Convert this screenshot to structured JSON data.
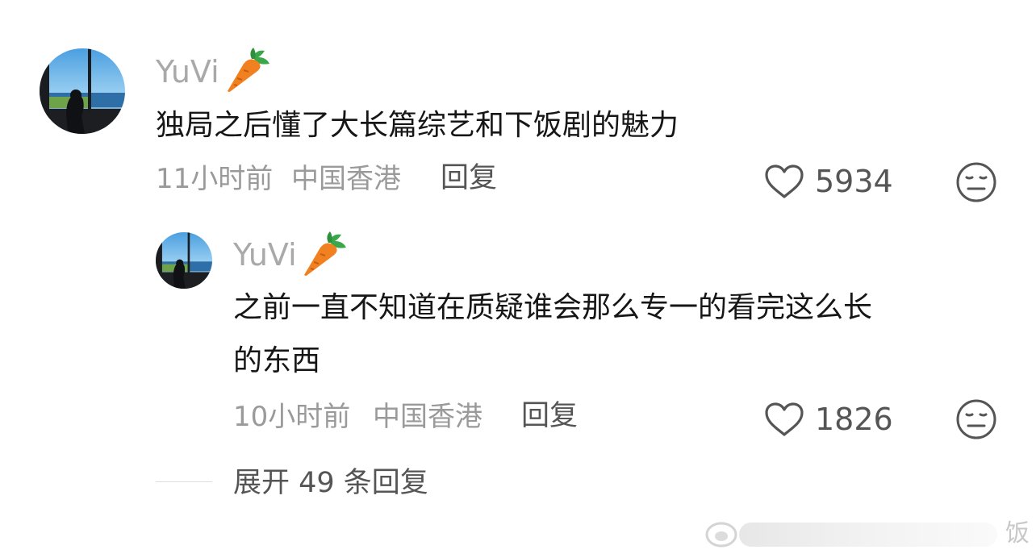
{
  "comments": [
    {
      "username": "YuVi",
      "badge": "carrot-emoji",
      "text": "独局之后懂了大长篇综艺和下饭剧的魅力",
      "time": "11小时前",
      "location": "中国香港",
      "reply_label": "回复",
      "likes": "5934",
      "reaction_icon": "neutral-face-icon"
    },
    {
      "username": "YuVi",
      "badge": "carrot-emoji",
      "text_line1": "之前一直不知道在质疑谁会那么专一的看完这么长",
      "text_line2": "的东西",
      "time": "10小时前",
      "location": "中国香港",
      "reply_label": "回复",
      "likes": "1826",
      "reaction_icon": "neutral-face-icon"
    }
  ],
  "expand_replies": "展开 49 条回复",
  "watermark": {
    "text": "饭"
  },
  "colors": {
    "username": "#a9a9a9",
    "content": "#161616",
    "meta": "#9a9a9a",
    "action": "#555555"
  }
}
